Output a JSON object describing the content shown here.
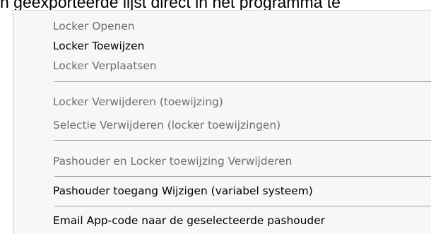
{
  "caption": {
    "text": "n geëxporteerde lijst direct in het programma te"
  },
  "menu": {
    "items": [
      {
        "label": "Locker Openen",
        "enabled": false
      },
      {
        "label": "Locker Toewijzen",
        "enabled": true
      },
      {
        "label": "Locker Verplaatsen",
        "enabled": false
      },
      {
        "label": "Locker Verwijderen (toewijzing)",
        "enabled": false
      },
      {
        "label": "Selectie Verwijderen (locker toewijzingen)",
        "enabled": false
      },
      {
        "label": "Pashouder en Locker toewijzing Verwijderen",
        "enabled": false
      },
      {
        "label": "Pashouder toegang Wijzigen (variabel systeem)",
        "enabled": true
      },
      {
        "label": "Email App-code naar de geselecteerde pashouder",
        "enabled": true
      }
    ]
  },
  "colors": {
    "menu_background": "#f7f7f7",
    "disabled_text": "#6d6d6d",
    "enabled_text": "#000000",
    "separator": "#a0a0a0"
  }
}
